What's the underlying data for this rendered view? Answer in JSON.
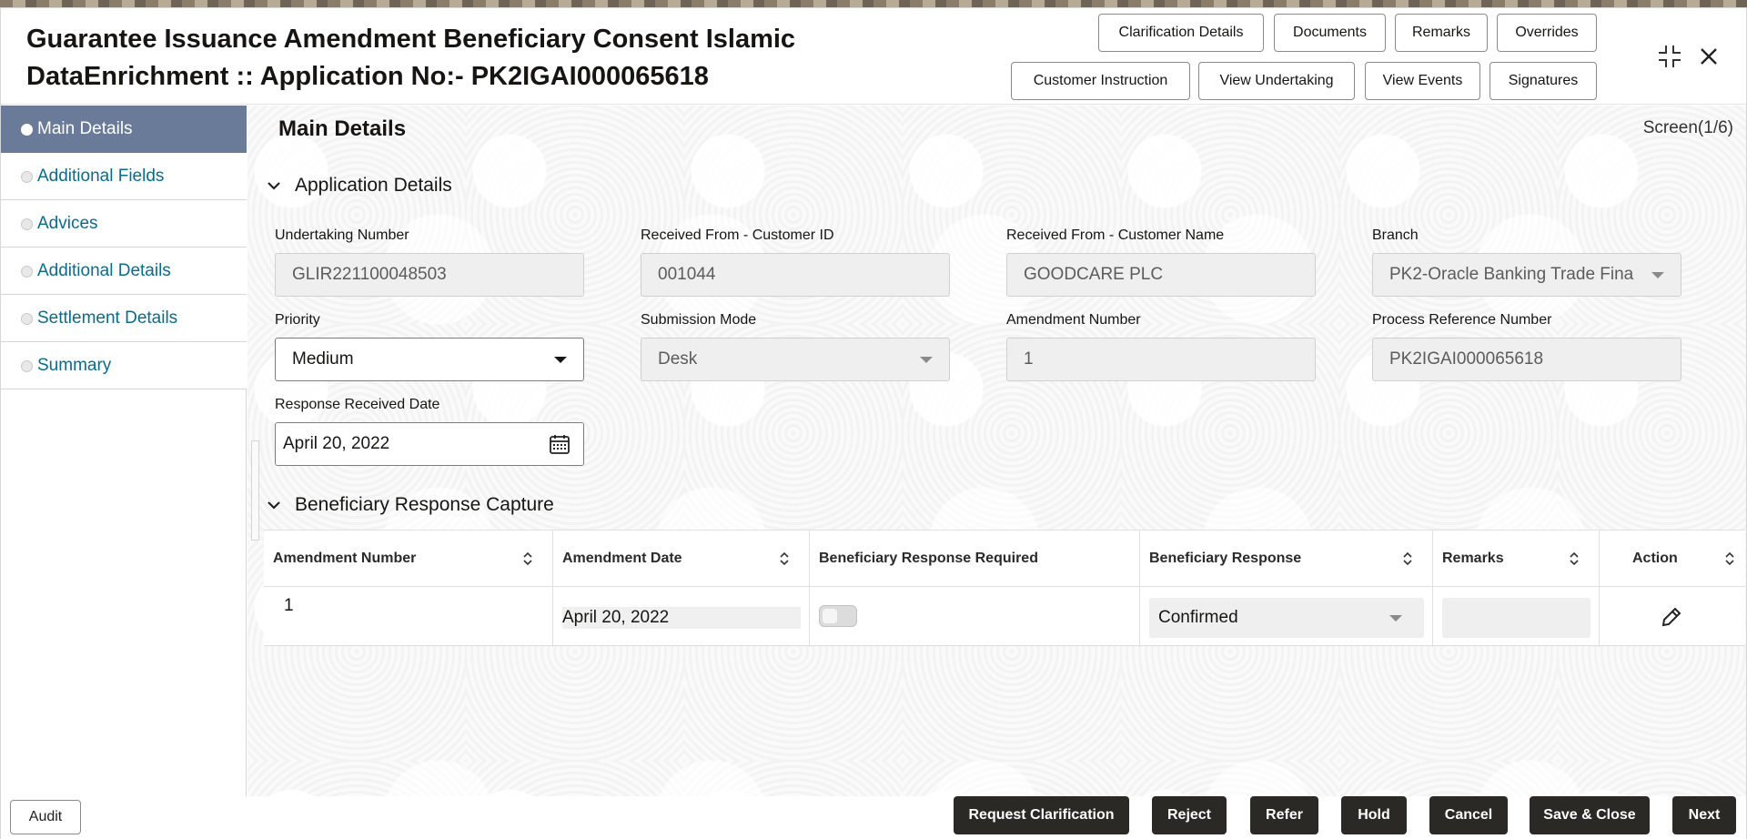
{
  "window": {
    "title_line1": "Guarantee Issuance Amendment Beneficiary Consent Islamic",
    "title_line2": "DataEnrichment :: Application No:- PK2IGAI000065618"
  },
  "header_buttons": {
    "clarification_details": "Clarification Details",
    "documents": "Documents",
    "remarks": "Remarks",
    "overrides": "Overrides",
    "customer_instruction": "Customer Instruction",
    "view_undertaking": "View Undertaking",
    "view_events": "View Events",
    "signatures": "Signatures"
  },
  "sidebar": {
    "items": [
      {
        "label": "Main Details",
        "active": true
      },
      {
        "label": "Additional Fields",
        "active": false
      },
      {
        "label": "Advices",
        "active": false
      },
      {
        "label": "Additional Details",
        "active": false
      },
      {
        "label": "Settlement Details",
        "active": false
      },
      {
        "label": "Summary",
        "active": false
      }
    ]
  },
  "main": {
    "title": "Main Details",
    "screen_indicator": "Screen(1/6)",
    "application_details": {
      "heading": "Application Details",
      "undertaking_number": {
        "label": "Undertaking Number",
        "value": "GLIR221100048503"
      },
      "customer_id": {
        "label": "Received From - Customer ID",
        "value": "001044"
      },
      "customer_name": {
        "label": "Received From - Customer Name",
        "value": "GOODCARE PLC"
      },
      "branch": {
        "label": "Branch",
        "value": "PK2-Oracle Banking Trade Fina"
      },
      "priority": {
        "label": "Priority",
        "value": "Medium"
      },
      "submission_mode": {
        "label": "Submission Mode",
        "value": "Desk"
      },
      "amendment_number": {
        "label": "Amendment Number",
        "value": "1"
      },
      "process_reference": {
        "label": "Process Reference Number",
        "value": "PK2IGAI000065618"
      },
      "response_received_date": {
        "label": "Response Received Date",
        "value": "April 20, 2022"
      }
    },
    "beneficiary_response": {
      "heading": "Beneficiary Response Capture",
      "columns": [
        "Amendment Number",
        "Amendment Date",
        "Beneficiary Response Required",
        "Beneficiary Response",
        "Remarks",
        "Action"
      ],
      "rows": [
        {
          "amendment_number": "1",
          "amendment_date": "April 20, 2022",
          "response_required": false,
          "response": "Confirmed",
          "remarks": ""
        }
      ]
    }
  },
  "footer": {
    "audit": "Audit",
    "request_clarification": "Request Clarification",
    "reject": "Reject",
    "refer": "Refer",
    "hold": "Hold",
    "cancel": "Cancel",
    "save_close": "Save & Close",
    "next": "Next"
  },
  "icons": {
    "collapse": "collapse-icon",
    "close": "close-icon",
    "calendar": "calendar-icon",
    "edit": "pencil-icon",
    "sort": "sort-icon",
    "chevron": "chevron-down-icon"
  }
}
